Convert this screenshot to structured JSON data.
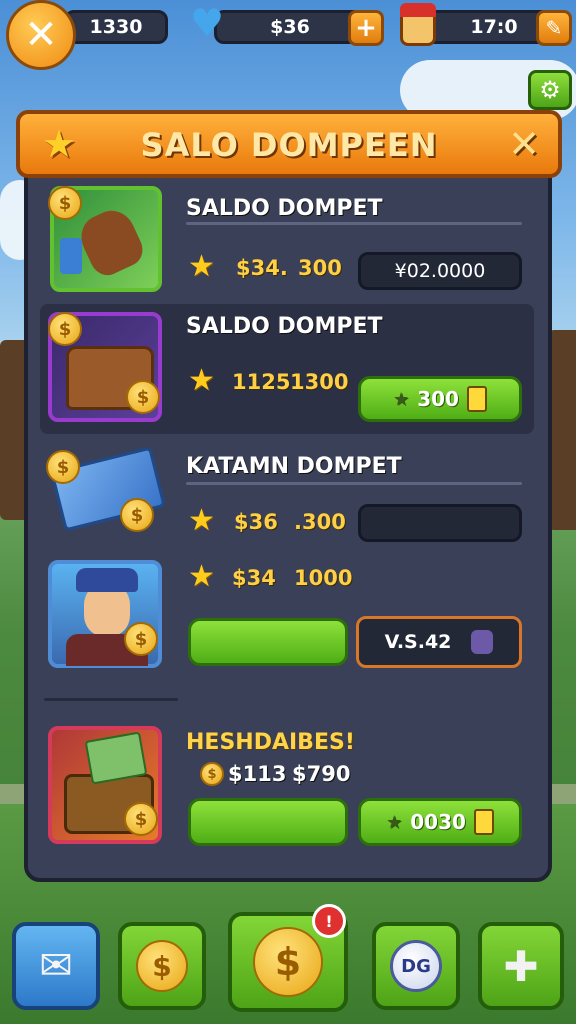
{
  "hud": {
    "counter_left": "1330",
    "counter_gems": "$36",
    "counter_time": "17:0"
  },
  "dialog": {
    "title": "SALO DOMPEEN"
  },
  "rows": [
    {
      "title": "SALDO DOMPET",
      "value_a": "$34.",
      "value_b": "300",
      "field": "¥02.0000"
    },
    {
      "title": "SALDO DOMPET",
      "value_a": "1125",
      "value_b": "1300",
      "button_value": "300"
    },
    {
      "title": "KATAMN DOMPET",
      "value_a": "$36",
      "value_b": ".300"
    },
    {
      "value_a": "$34",
      "value_b": "1000",
      "field": "V.S.42"
    },
    {
      "title": "HESHDAIBES!",
      "value_a": "$113",
      "value_b": "$790",
      "button_value": "0030"
    }
  ],
  "nav": {
    "profile_label": "DG"
  },
  "colors": {
    "accent_orange": "#f08a12",
    "panel": "#3a4057",
    "green": "#5fbf1f"
  }
}
